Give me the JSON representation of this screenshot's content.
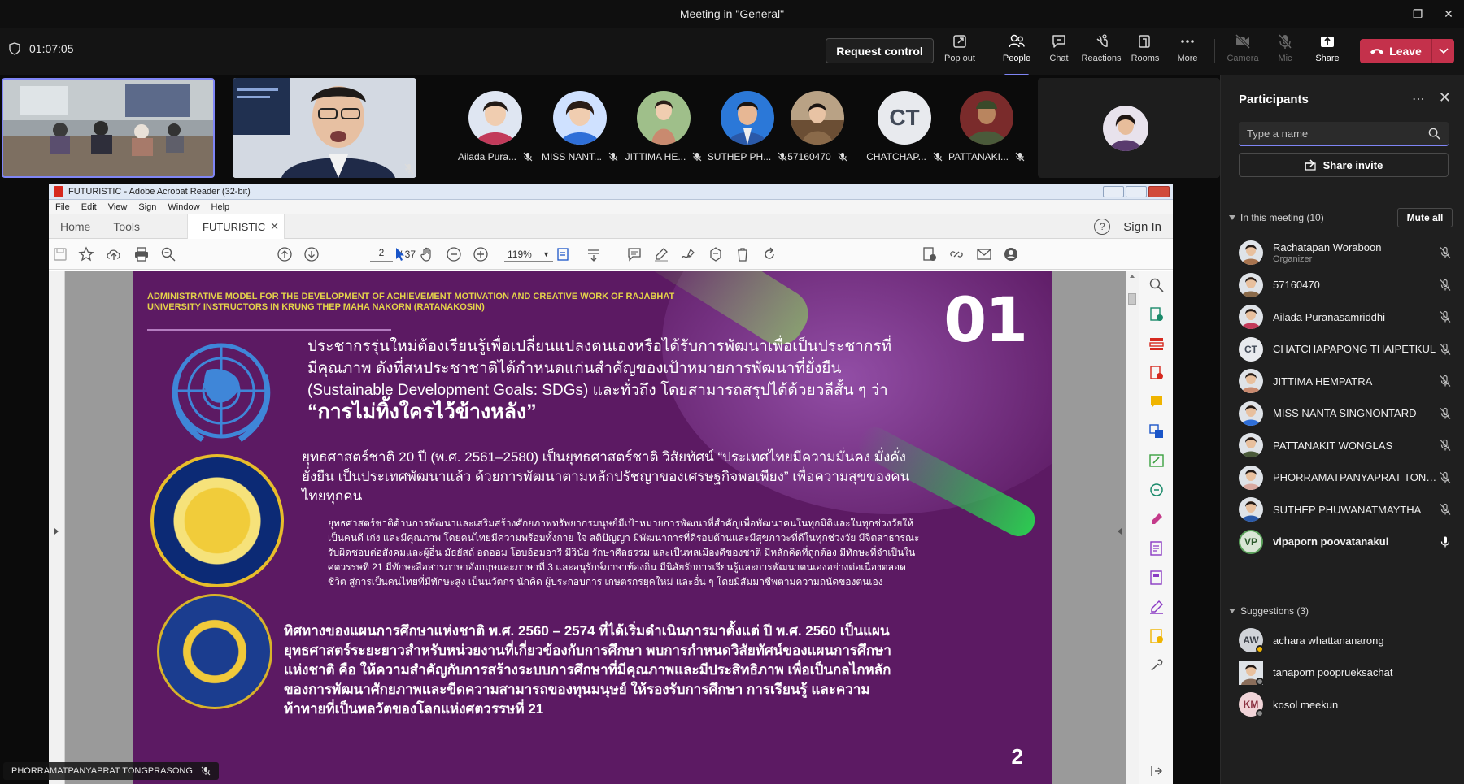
{
  "window": {
    "title": "Meeting in \"General\""
  },
  "toolbar": {
    "elapsed": "01:07:05",
    "request_control": "Request control",
    "tools": [
      {
        "label": "Pop out",
        "icon": "pop-out-icon"
      },
      {
        "label": "People",
        "icon": "people-icon"
      },
      {
        "label": "Chat",
        "icon": "chat-icon"
      },
      {
        "label": "Reactions",
        "icon": "reactions-icon"
      },
      {
        "label": "Rooms",
        "icon": "rooms-icon"
      },
      {
        "label": "More",
        "icon": "more-icon"
      },
      {
        "label": "Camera",
        "icon": "camera-off-icon"
      },
      {
        "label": "Mic",
        "icon": "mic-off-icon"
      },
      {
        "label": "Share",
        "icon": "share-icon"
      }
    ],
    "leave": "Leave"
  },
  "video_strip": {
    "tiles": [
      {
        "name": "Ailada Pura...",
        "color": "#c23a5a"
      },
      {
        "name": "MISS NANT...",
        "color": "#2f6fd8"
      },
      {
        "name": "JITTIMA HE...",
        "color": "#c98a6f"
      },
      {
        "name": "SUTHEP PH...",
        "color": "#2a59a8"
      },
      {
        "name": "57160470",
        "color": "#8a6a4a"
      },
      {
        "name": "CHATCHAP...",
        "initials": "CT"
      },
      {
        "name": "PATTANAKI...",
        "color": "#4a5a3a"
      }
    ]
  },
  "acrobat": {
    "title": "FUTURISTIC - Adobe Acrobat Reader (32-bit)",
    "menu": [
      "File",
      "Edit",
      "View",
      "Sign",
      "Window",
      "Help"
    ],
    "tabs": {
      "home": "Home",
      "tools": "Tools",
      "document": "FUTURISTIC"
    },
    "sign_in": "Sign In",
    "help": "?",
    "page_current": "2",
    "page_total": "/ 37",
    "zoom": "119%"
  },
  "pdf_page": {
    "header": "ADMINISTRATIVE MODEL FOR THE DEVELOPMENT OF ACHIEVEMENT MOTIVATION AND CREATIVE WORK OF RAJABHAT UNIVERSITY INSTRUCTORS IN KRUNG THEP MAHA NAKORN (RATANAKOSIN)",
    "number": "01",
    "footer_number": "2",
    "para1": "ประชากรรุ่นใหม่ต้องเรียนรู้เพื่อเปลี่ยนแปลงตนเองหรือได้รับการพัฒนาเพื่อเป็นประชากรที่มีคุณภาพ ดังที่สหประชาชาติได้กำหนดแก่นสำคัญของเป้าหมายการพัฒนาที่ยั่งยืน (Sustainable Development Goals: SDGs) และทั่วถึง โดยสามารถสรุปได้ด้วยวลีสั้น ๆ ว่า",
    "para1_quote": "“การไม่ทิ้งใครไว้ข้างหลัง”",
    "para2": "ยุทธศาสตร์ชาติ 20 ปี (พ.ศ. 2561–2580) เป็นยุทธศาสตร์ชาติ วิสัยทัศน์ “ประเทศไทยมีความมั่นคง มั่งคั่ง ยั่งยืน เป็นประเทศพัฒนาแล้ว ด้วยการพัฒนาตามหลักปรัชญาของเศรษฐกิจพอเพียง” เพื่อความสุขของคนไทยทุกคน",
    "para3": "ยุทธศาสตร์ชาติด้านการพัฒนาและเสริมสร้างศักยภาพทรัพยากรมนุษย์มีเป้าหมายการพัฒนาที่สำคัญเพื่อพัฒนาคนในทุกมิติและในทุกช่วงวัยให้เป็นคนดี เก่ง และมีคุณภาพ โดยคนไทยมีความพร้อมทั้งกาย ใจ สติปัญญา มีพัฒนาการที่ดีรอบด้านและมีสุขภาวะที่ดีในทุกช่วงวัย มีจิตสาธารณะ รับผิดชอบต่อสังคมและผู้อื่น มัธยัสถ์ อดออม โอบอ้อมอารี มีวินัย รักษาศีลธรรม และเป็นพลเมืองดีของชาติ มีหลักคิดที่ถูกต้อง มีทักษะที่จำเป็นในศตวรรษที่ 21 มีทักษะสื่อสารภาษาอังกฤษและภาษาที่ 3 และอนุรักษ์ภาษาท้องถิ่น มีนิสัยรักการเรียนรู้และการพัฒนาตนเองอย่างต่อเนื่องตลอดชีวิต สู่การเป็นคนไทยที่มีทักษะสูง เป็นนวัตกร นักคิด ผู้ประกอบการ เกษตรกรยุคใหม่ และอื่น ๆ โดยมีสัมมาชีพตามความถนัดของตนเอง",
    "para4": "ทิศทางของแผนการศึกษาแห่งชาติ พ.ศ. 2560 – 2574 ที่ได้เริ่มดำเนินการมาตั้งแต่ ปี พ.ศ. 2560 เป็นแผนยุทธศาสตร์ระยะยาวสำหรับหน่วยงานที่เกี่ยวข้องกับการศึกษา พบการกำหนดวิสัยทัศน์ของแผนการศึกษาแห่งชาติ คือ ให้ความสำคัญกับการสร้างระบบการศึกษาที่มีคุณภาพและมีประสิทธิภาพ เพื่อเป็นกลไกหลักของการพัฒนาศักยภาพและขีดความสามารถของทุนมนุษย์ ให้รองรับการศึกษา การเรียนรู้ และความท้าทายที่เป็นพลวัตของโลกแห่งศตวรรษที่ 21"
  },
  "stage": {
    "presenter_label": "PHORRAMATPANYAPRAT TONGPRASONG"
  },
  "participants_panel": {
    "title": "Participants",
    "search_placeholder": "Type a name",
    "share_invite": "Share invite",
    "in_meeting_label": "In this meeting (10)",
    "mute_all": "Mute all",
    "suggestions_label": "Suggestions (3)",
    "in_meeting": [
      {
        "name": "Rachatapan Woraboon",
        "role": "Organizer",
        "color": "#a8744f"
      },
      {
        "name": "57160470",
        "color": "#8a6a4a"
      },
      {
        "name": "Ailada Puranasamriddhi",
        "color": "#c23a5a"
      },
      {
        "name": "CHATCHAPAPONG THAIPETKUL",
        "initials": "CT"
      },
      {
        "name": "JITTIMA HEMPATRA",
        "color": "#c98a6f"
      },
      {
        "name": "MISS NANTA SINGNONTARD",
        "color": "#2f6fd8"
      },
      {
        "name": "PATTANAKIT WONGLAS",
        "color": "#4a5a3a"
      },
      {
        "name": "PHORRAMATPANYAPRAT TONG...",
        "color": "#d9a9a0"
      },
      {
        "name": "SUTHEP PHUWANATMAYTHA",
        "color": "#2a59a8"
      },
      {
        "name": "vipaporn poovatanakul",
        "initials": "VP"
      }
    ],
    "suggestions": [
      {
        "name": "achara whattananarong",
        "initials": "AW"
      },
      {
        "name": "tanaporn pooprueksachat",
        "color": "#8a6d5a"
      },
      {
        "name": "kosol meekun",
        "initials": "KM"
      }
    ]
  }
}
